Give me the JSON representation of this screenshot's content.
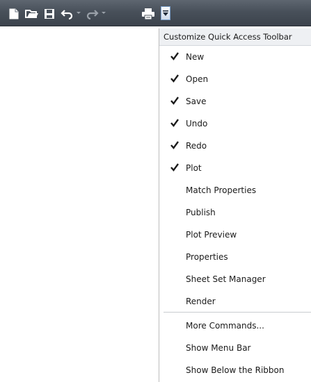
{
  "toolbar": {
    "buttons": [
      {
        "name": "new",
        "icon": "new-document-icon"
      },
      {
        "name": "open",
        "icon": "open-folder-icon"
      },
      {
        "name": "save",
        "icon": "save-disk-icon"
      },
      {
        "name": "undo",
        "icon": "undo-arrow-icon"
      },
      {
        "name": "redo",
        "icon": "redo-arrow-icon"
      },
      {
        "name": "plot",
        "icon": "printer-icon"
      }
    ],
    "customize_icon": "chevron-down-icon",
    "colors": {
      "bar_top": "#5e6670",
      "bar_bottom": "#3c434c",
      "icon": "#ffffff",
      "accent": "#7da2ce"
    }
  },
  "menu": {
    "header": "Customize Quick Access Toolbar",
    "items": [
      {
        "label": "New",
        "checked": true
      },
      {
        "label": "Open",
        "checked": true
      },
      {
        "label": "Save",
        "checked": true
      },
      {
        "label": "Undo",
        "checked": true
      },
      {
        "label": "Redo",
        "checked": true
      },
      {
        "label": "Plot",
        "checked": true
      },
      {
        "label": "Match Properties",
        "checked": false
      },
      {
        "label": "Publish",
        "checked": false
      },
      {
        "label": "Plot Preview",
        "checked": false
      },
      {
        "label": "Properties",
        "checked": false
      },
      {
        "label": "Sheet Set Manager",
        "checked": false
      },
      {
        "label": "Render",
        "checked": false
      }
    ],
    "extra_items": [
      {
        "label": "More Commands..."
      },
      {
        "label": "Show Menu Bar"
      },
      {
        "label": "Show Below the Ribbon"
      }
    ]
  }
}
